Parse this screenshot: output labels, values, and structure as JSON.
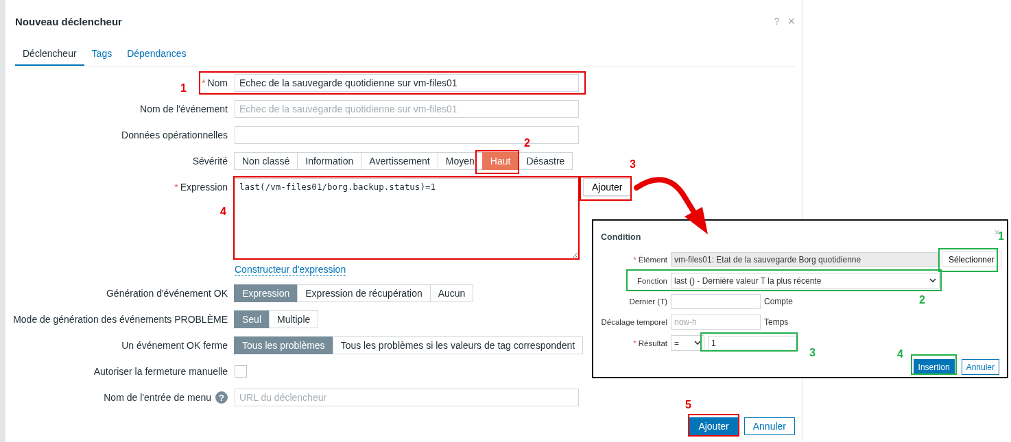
{
  "dialog": {
    "title": "Nouveau déclencheur",
    "help_glyph": "?",
    "close_glyph": "×"
  },
  "tabs": [
    {
      "label": "Déclencheur",
      "selected": true
    },
    {
      "label": "Tags",
      "selected": false
    },
    {
      "label": "Dépendances",
      "selected": false
    }
  ],
  "form": [
    {
      "kind": "input",
      "label": "Nom",
      "required_mark": "*",
      "value": "Echec de la sauvegarde quotidienne sur vm-files01"
    },
    {
      "kind": "input",
      "label": "Nom de l'événement",
      "placeholder": "Echec de la sauvegarde quotidienne sur vm-files01"
    },
    {
      "kind": "input",
      "label": "Données opérationnelles"
    },
    {
      "kind": "severity",
      "label": "Sévérité",
      "options": [
        {
          "label": "Non classé",
          "selected": false
        },
        {
          "label": "Information",
          "selected": false
        },
        {
          "label": "Avertissement",
          "selected": false
        },
        {
          "label": "Moyen",
          "selected": false
        },
        {
          "label": "Haut",
          "selected": true
        },
        {
          "label": "Désastre",
          "selected": false
        }
      ]
    },
    {
      "kind": "expression",
      "label": "Expression",
      "required_mark": "*",
      "value": "last(/vm-files01/borg.backup.status)=1",
      "button": "Ajouter",
      "link": "Constructeur d'expression"
    },
    {
      "kind": "segmented",
      "label": "Génération d'événement OK",
      "options": [
        {
          "label": "Expression",
          "selected": true
        },
        {
          "label": "Expression de récupération",
          "selected": false
        },
        {
          "label": "Aucun",
          "selected": false
        }
      ]
    },
    {
      "kind": "segmented",
      "label": "Mode de génération des événements PROBLÈME",
      "options": [
        {
          "label": "Seul",
          "selected": true
        },
        {
          "label": "Multiple",
          "selected": false
        }
      ]
    },
    {
      "kind": "segmented",
      "label": "Un événement OK ferme",
      "options": [
        {
          "label": "Tous les problèmes",
          "selected": true
        },
        {
          "label": "Tous les problèmes si les valeurs de tag correspondent",
          "selected": false
        }
      ]
    },
    {
      "kind": "checkbox",
      "label": "Autoriser la fermeture manuelle",
      "checked": false
    },
    {
      "kind": "input",
      "label": "Nom de l'entrée de menu",
      "help_glyph": "?",
      "placeholder": "URL du déclencheur"
    }
  ],
  "footer_buttons": [
    {
      "label": "Ajouter",
      "primary": true
    },
    {
      "label": "Annuler",
      "primary": false
    }
  ],
  "condition": {
    "title": "Condition",
    "close_glyph": "×",
    "rows": [
      {
        "kind": "item",
        "label": "Élément",
        "required_mark": "*",
        "value": "vm-files01: Etat de la sauvegarde Borg quotidienne",
        "button": "Sélectionner"
      },
      {
        "kind": "select",
        "label": "Fonction",
        "value": "last () - Dernière valeur T la plus récente"
      },
      {
        "kind": "input",
        "label": "Dernier (T)",
        "suffix": "Compte"
      },
      {
        "kind": "input",
        "label": "Décalage temporel",
        "placeholder": "now-h",
        "suffix": "Temps"
      },
      {
        "kind": "result",
        "label": "Résultat",
        "required_mark": "*",
        "operator": "=",
        "value": "1"
      }
    ],
    "buttons": [
      {
        "label": "Insertion",
        "primary": true
      },
      {
        "label": "Annuler",
        "primary": false
      }
    ]
  },
  "annotations": [
    {
      "number": "1",
      "color": "#e60000"
    },
    {
      "number": "2",
      "color": "#e60000"
    },
    {
      "number": "3",
      "color": "#e60000"
    },
    {
      "number": "4",
      "color": "#e60000"
    },
    {
      "number": "5",
      "color": "#e60000"
    },
    {
      "number": "1",
      "color": "#22b04b"
    },
    {
      "number": "2",
      "color": "#22b04b"
    },
    {
      "number": "3",
      "color": "#22b04b"
    },
    {
      "number": "4",
      "color": "#22b04b"
    }
  ]
}
